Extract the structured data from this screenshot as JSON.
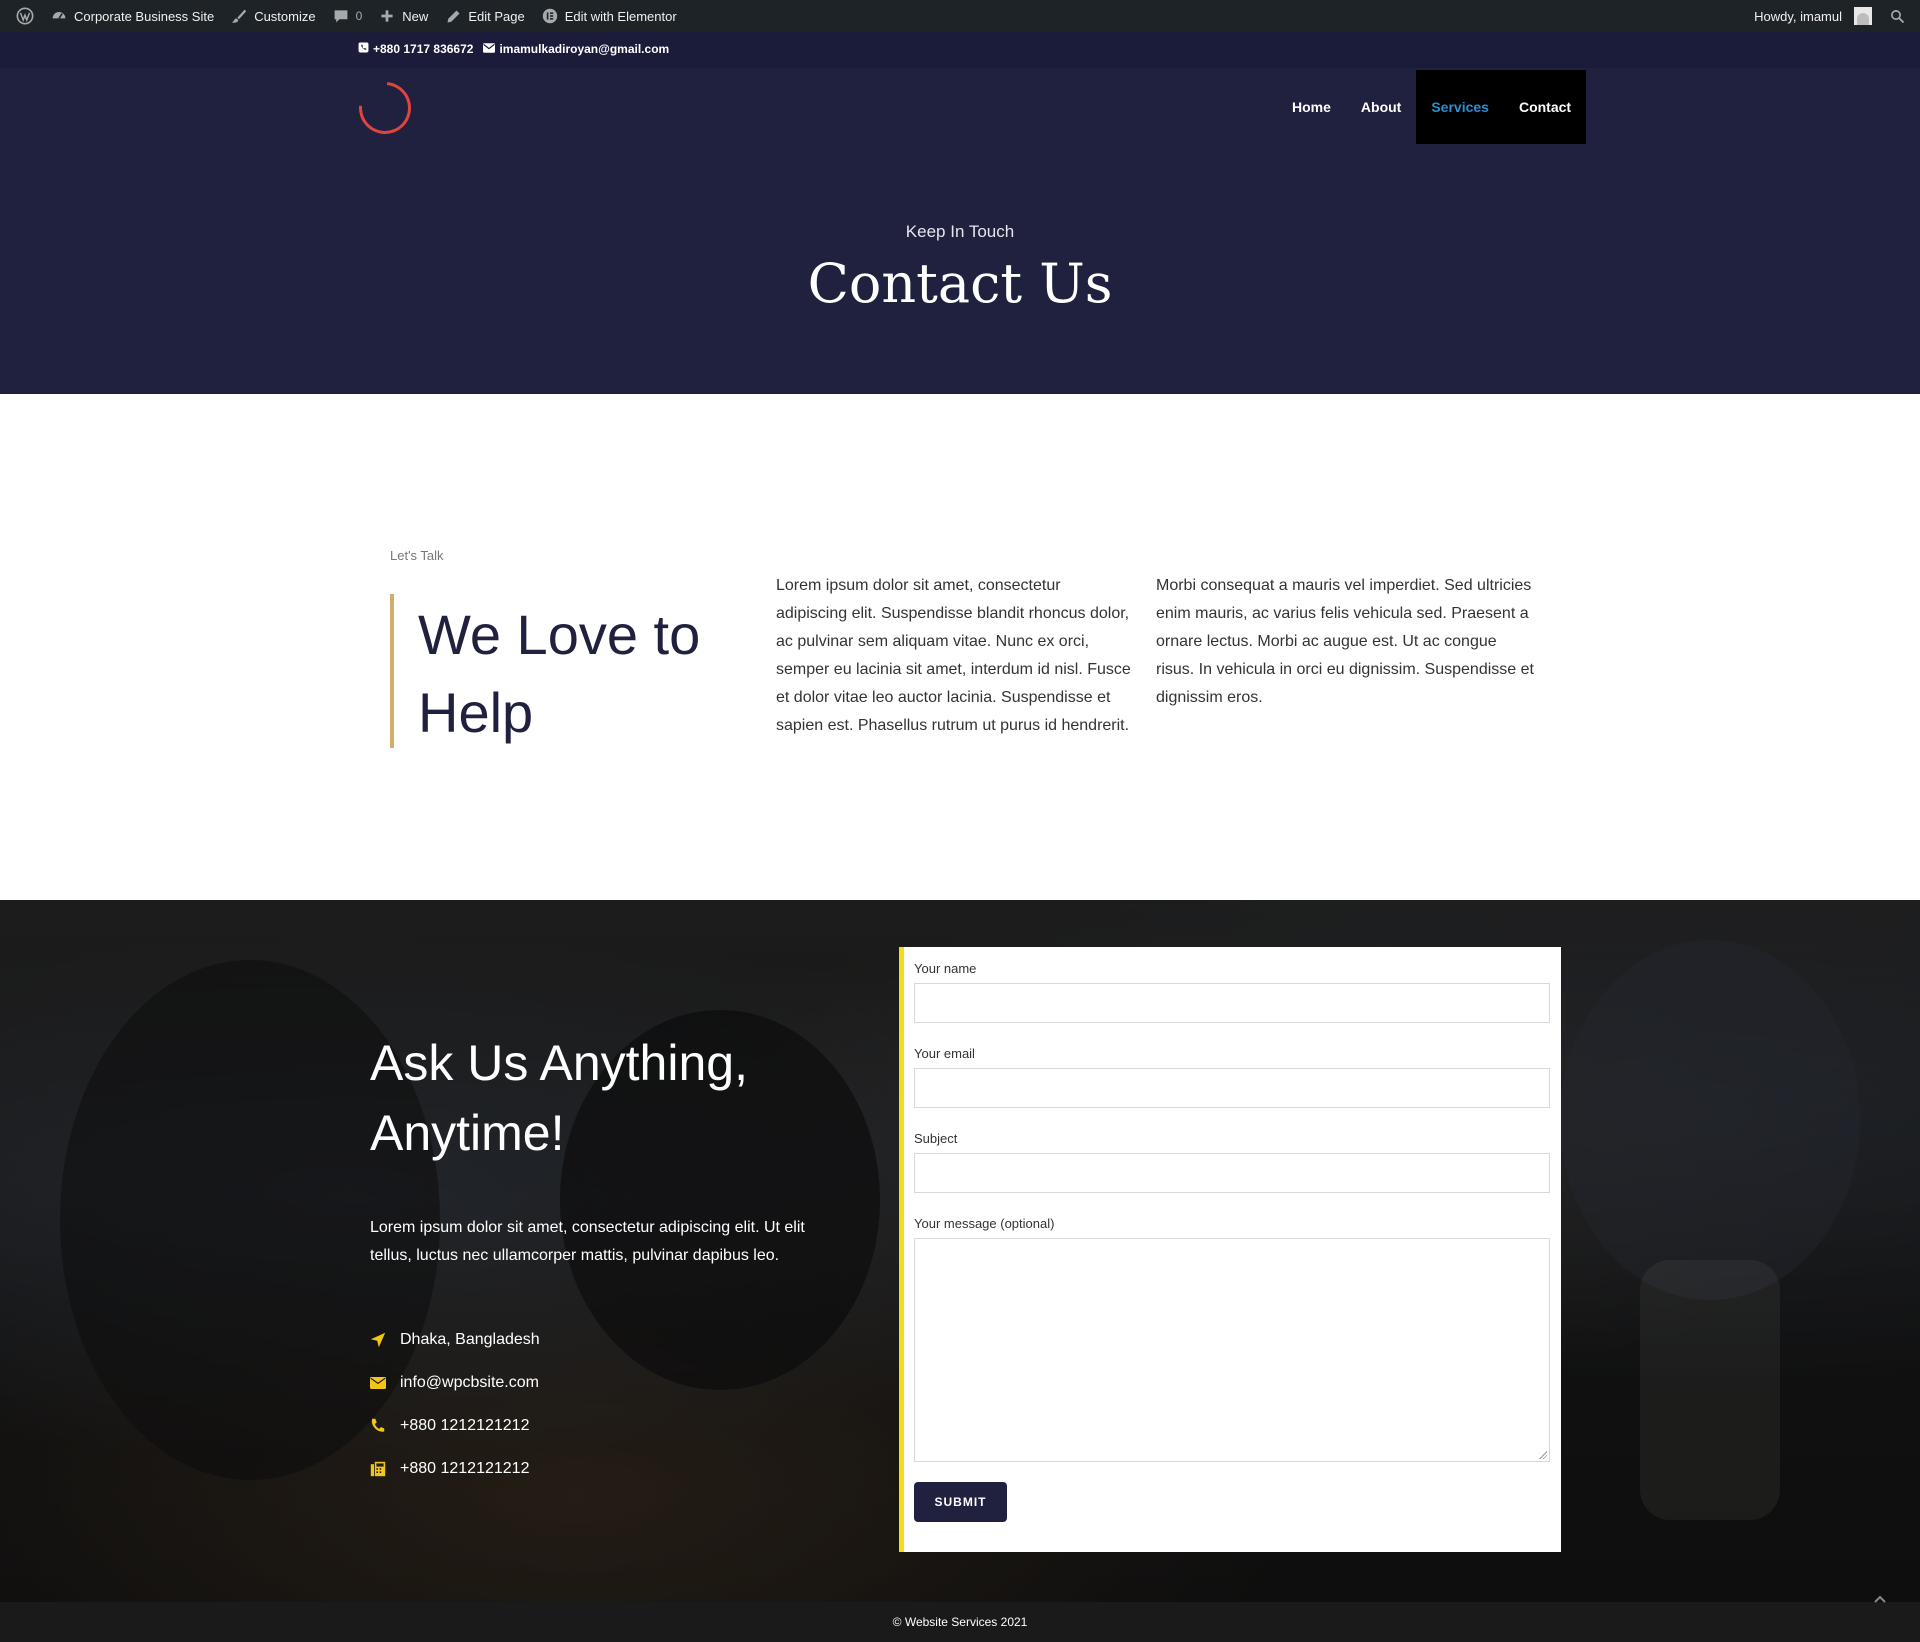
{
  "admin_bar": {
    "site_name": "Corporate Business Site",
    "customize": "Customize",
    "comments_count": "0",
    "new": "New",
    "edit_page": "Edit Page",
    "edit_elementor": "Edit with Elementor",
    "howdy": "Howdy, imamul"
  },
  "topbar": {
    "phone": "+880 1717 836672",
    "email": "imamulkadiroyan@gmail.com"
  },
  "nav": {
    "items": [
      {
        "label": "Home"
      },
      {
        "label": "About"
      },
      {
        "label": "Services"
      },
      {
        "label": "Contact"
      }
    ]
  },
  "hero": {
    "subtitle": "Keep In Touch",
    "title": "Contact Us"
  },
  "intro": {
    "eyebrow": "Let's Talk",
    "heading_line1": "We Love to",
    "heading_line2": "Help",
    "paragraph1": "Lorem ipsum dolor sit amet, consectetur adipiscing elit. Suspendisse blandit rhoncus dolor, ac pulvinar sem aliquam vitae. Nunc ex orci, semper eu lacinia sit amet, interdum id nisl. Fusce et dolor vitae leo auctor lacinia. Suspendisse et sapien est. Phasellus rutrum ut purus id hendrerit.",
    "paragraph2": "Morbi consequat a mauris vel imperdiet. Sed ultricies enim mauris, ac varius felis vehicula sed. Praesent a ornare lectus. Morbi ac augue est. Ut ac congue risus. In vehicula in orci eu dignissim. Suspendisse et dignissim eros."
  },
  "contact": {
    "heading_line1": "Ask Us Anything,",
    "heading_line2": "Anytime!",
    "text": "Lorem ipsum dolor sit amet, consectetur adipiscing elit. Ut elit tellus, luctus nec ullamcorper mattis, pulvinar dapibus leo.",
    "info": [
      {
        "icon": "location-arrow-icon",
        "text": "Dhaka, Bangladesh"
      },
      {
        "icon": "envelope-icon",
        "text": "info@wpcbsite.com"
      },
      {
        "icon": "phone-icon",
        "text": "+880 1212121212"
      },
      {
        "icon": "fax-icon",
        "text": "+880 1212121212"
      }
    ],
    "colors": {
      "accent": "#f3c517",
      "card_border": "#f3dd17"
    }
  },
  "form": {
    "name_label": "Your name",
    "name_value": "",
    "email_label": "Your email",
    "email_value": "",
    "subject_label": "Subject",
    "subject_value": "",
    "message_label": "Your message (optional)",
    "message_value": "",
    "submit_label": "SUBMIT"
  },
  "footer": {
    "copyright": "© Website Services 2021"
  },
  "colors": {
    "header_bg": "#20203f",
    "admin_bar_bg": "#1d2327",
    "nav_active": "#2a8fd4",
    "logo": "#e0443d",
    "heading_accent": "#d2ae6d"
  }
}
